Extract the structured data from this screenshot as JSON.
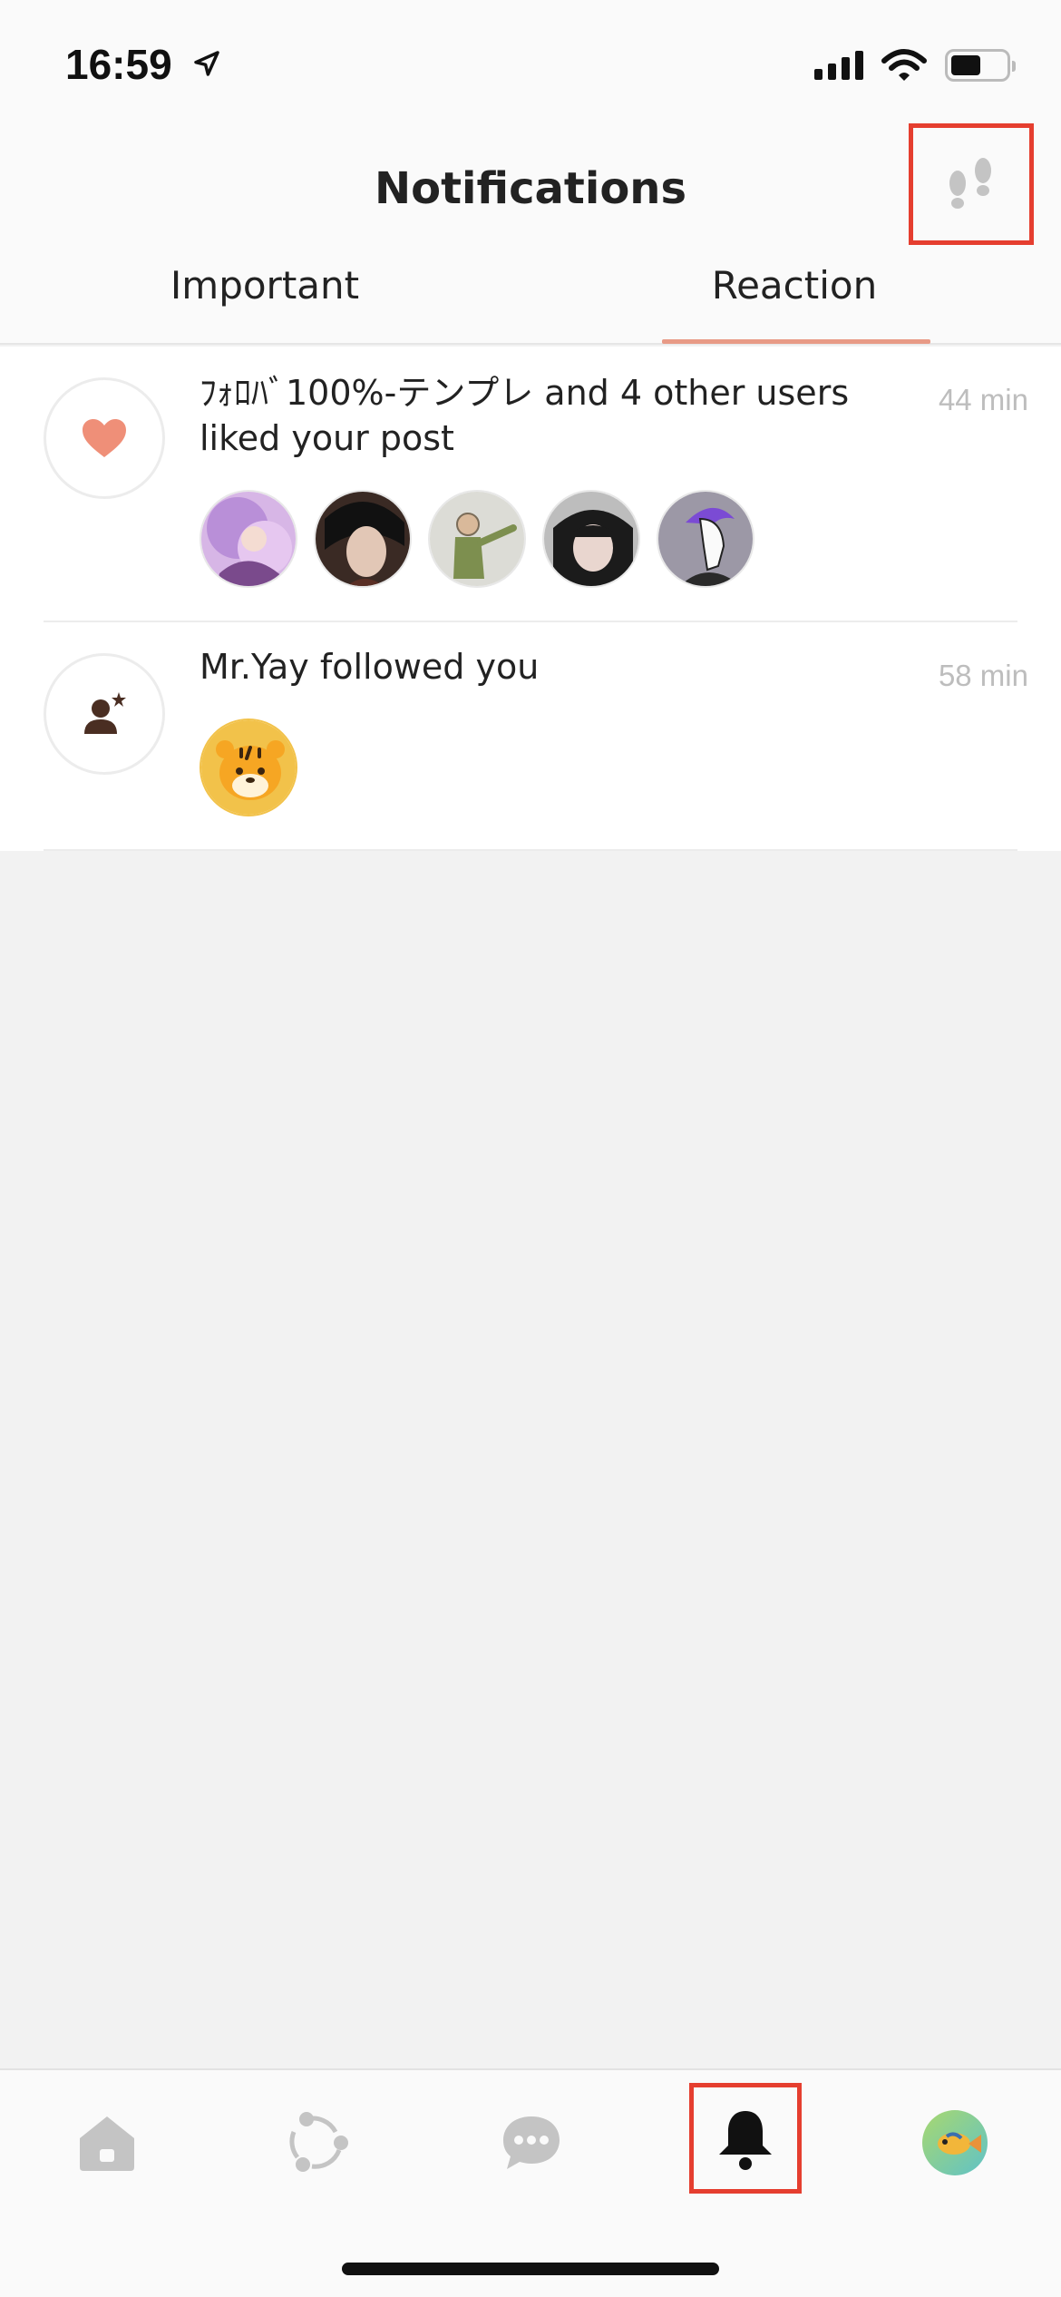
{
  "status_bar": {
    "time": "16:59",
    "location_icon": "location-arrow-icon",
    "signal_icon": "cellular-signal-icon",
    "wifi_icon": "wifi-icon",
    "battery_icon": "battery-icon"
  },
  "header": {
    "title": "Notifications",
    "footprints_icon": "footprints-icon"
  },
  "tabs": [
    {
      "label": "Important",
      "selected": false
    },
    {
      "label": "Reaction",
      "selected": true
    }
  ],
  "notifications": [
    {
      "type_icon": "heart-icon",
      "text": "ﾌｫﾛﾊﾞ100%-テンプレ and 4 other users liked your post",
      "time": "44 min",
      "avatars": [
        "avatar-purple-hair",
        "avatar-dark-hair",
        "avatar-sketch",
        "avatar-portrait",
        "avatar-purple-lineart"
      ]
    },
    {
      "type_icon": "add-user-icon",
      "text": "Mr.Yay followed you",
      "time": "58 min",
      "avatars": [
        "avatar-tiger"
      ]
    }
  ],
  "bottom_nav": [
    {
      "name": "home",
      "icon": "home-icon",
      "active": false
    },
    {
      "name": "timeline",
      "icon": "timeline-icon",
      "active": false
    },
    {
      "name": "chat",
      "icon": "chat-bubble-icon",
      "active": false
    },
    {
      "name": "notifications",
      "icon": "bell-icon",
      "active": true
    },
    {
      "name": "profile",
      "icon": "profile-avatar-fish",
      "active": false
    }
  ],
  "colors": {
    "accent": "#e89a86",
    "highlight_box": "#e53e2f",
    "heart": "#ef8f78",
    "inactive_icon": "#c4c4c4",
    "time_text": "#bdbdbd"
  }
}
